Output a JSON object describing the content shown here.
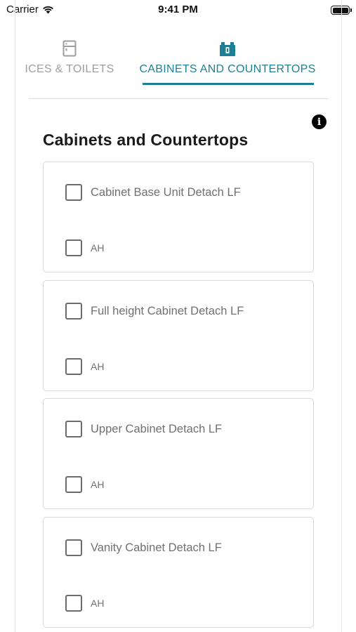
{
  "status_bar": {
    "carrier": "Carrier",
    "time": "9:41 PM"
  },
  "tabs": [
    {
      "label": "ICES & TOILETS",
      "icon": "fridge-icon",
      "active": false
    },
    {
      "label": "CABINETS AND COUNTERTOPS",
      "icon": "cabinet-icon",
      "active": true
    }
  ],
  "accent_color": "#1e7f94",
  "section": {
    "title": "Cabinets and Countertops",
    "cards": [
      {
        "label": "Cabinet Base Unit Detach LF",
        "sub_label": "AH"
      },
      {
        "label": "Full height Cabinet Detach LF",
        "sub_label": "AH"
      },
      {
        "label": "Upper Cabinet Detach LF",
        "sub_label": "AH"
      },
      {
        "label": "Vanity Cabinet Detach LF",
        "sub_label": "AH"
      }
    ]
  }
}
